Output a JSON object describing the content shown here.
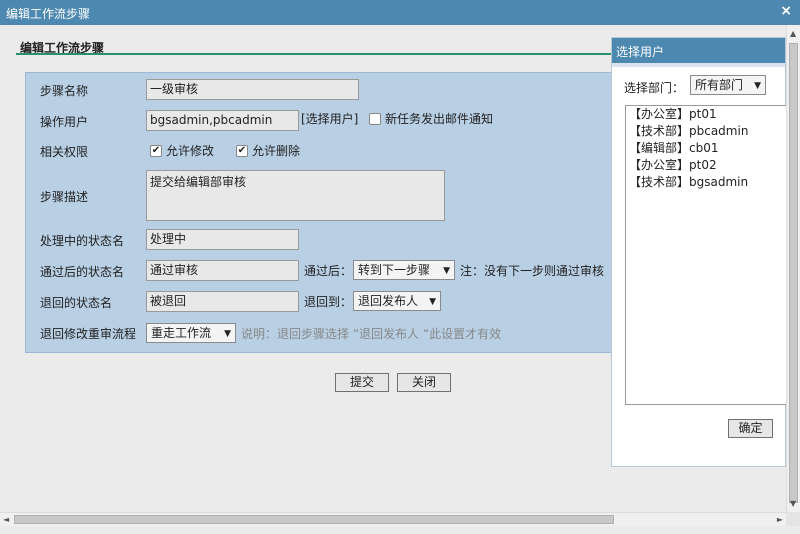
{
  "window": {
    "title": "编辑工作流步骤",
    "close_symbol": "×"
  },
  "section": {
    "title": "编辑工作流步骤"
  },
  "form": {
    "step_name_label": "步骤名称",
    "step_name_value": "一级审核",
    "operator_label": "操作用户",
    "operator_value": "bgsadmin,pbcadmin",
    "select_user_link": "[选择用户]",
    "email_notify_label": "新任务发出邮件通知",
    "email_notify_checked": false,
    "permissions_label": "相关权限",
    "allow_edit_label": "允许修改",
    "allow_edit_checked": true,
    "allow_delete_label": "允许删除",
    "allow_delete_checked": true,
    "description_label": "步骤描述",
    "description_value": "提交给编辑部审核",
    "processing_status_label": "处理中的状态名",
    "processing_status_value": "处理中",
    "passed_status_label": "通过后的状态名",
    "passed_status_value": "通过审核",
    "after_pass_label": "通过后：",
    "after_pass_selected": "转到下一步骤",
    "after_pass_note": "注：没有下一步则通过审核",
    "rejected_status_label": "退回的状态名",
    "rejected_status_value": "被退回",
    "return_to_label": "退回到：",
    "return_to_selected": "退回发布人",
    "reprocess_label": "退回修改重审流程",
    "reprocess_selected": "重走工作流",
    "reprocess_note": "说明：退回步骤选择 “退回发布人 “此设置才有效",
    "check_mark": "✔"
  },
  "buttons": {
    "submit": "提交",
    "close": "关闭"
  },
  "user_panel": {
    "title": "选择用户",
    "dept_label": "选择部门：",
    "dept_selected": "所有部门",
    "users": [
      "【办公室】pt01",
      "【技术部】pbcadmin",
      "【编辑部】cb01",
      "【办公室】pt02",
      "【技术部】bgsadmin"
    ],
    "confirm": "确定"
  },
  "icons": {
    "dropdown": "▼",
    "scroll_up": "▲",
    "scroll_down": "▼",
    "scroll_left": "◄",
    "scroll_right": "►"
  }
}
